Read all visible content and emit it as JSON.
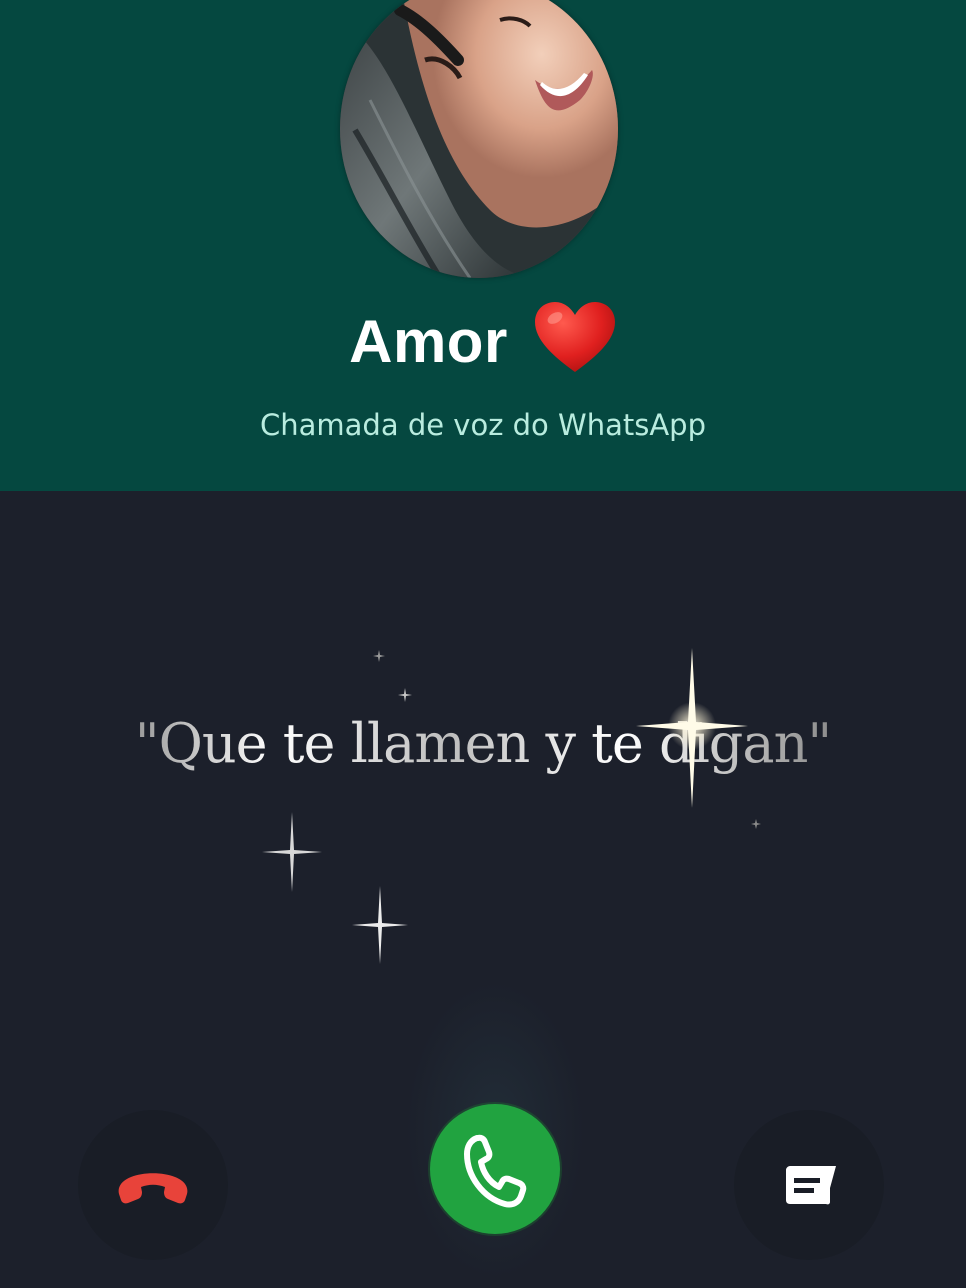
{
  "caller": {
    "name": "Amor",
    "name_emoji": "red-heart-icon",
    "call_type": "Chamada de voz do WhatsApp"
  },
  "lyric": {
    "text": "\"Que te llamen y te digan\""
  },
  "actions": {
    "decline": "decline-call-icon",
    "accept": "accept-call-icon",
    "message": "reply-message-icon"
  },
  "colors": {
    "header_bg": "#054840",
    "body_bg": "#1c202b",
    "call_type_text": "#b9ecdf",
    "accept_green": "#21a340",
    "decline_red": "#e8433a",
    "heart_red": "#e0201f"
  }
}
